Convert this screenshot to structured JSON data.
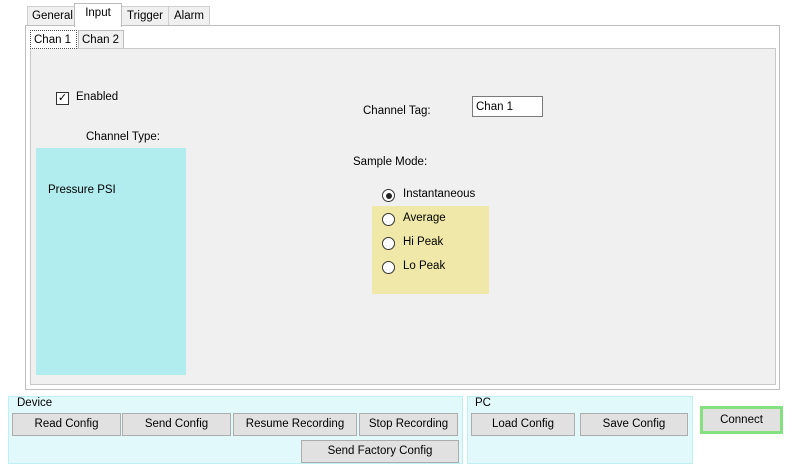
{
  "tabs": [
    "General",
    "Input",
    "Trigger",
    "Alarm"
  ],
  "subtabs": [
    "Chan 1",
    "Chan 2"
  ],
  "channel": {
    "enabled_label": "Enabled",
    "enabled_checked": true,
    "type_label": "Channel Type:",
    "types": [
      "Pressure PSI"
    ],
    "tag_label": "Channel Tag:",
    "tag_value": "Chan 1"
  },
  "sample_mode": {
    "label": "Sample Mode:",
    "options": [
      "Instantaneous",
      "Average",
      "Hi Peak",
      "Lo Peak"
    ],
    "selected": "Instantaneous"
  },
  "device": {
    "title": "Device",
    "buttons": {
      "read": "Read Config",
      "send": "Send Config",
      "resume": "Resume Recording",
      "stop": "Stop Recording",
      "factory": "Send Factory Config"
    }
  },
  "pc": {
    "title": "PC",
    "buttons": {
      "load": "Load Config",
      "save": "Save Config"
    }
  },
  "connect_label": "Connect"
}
